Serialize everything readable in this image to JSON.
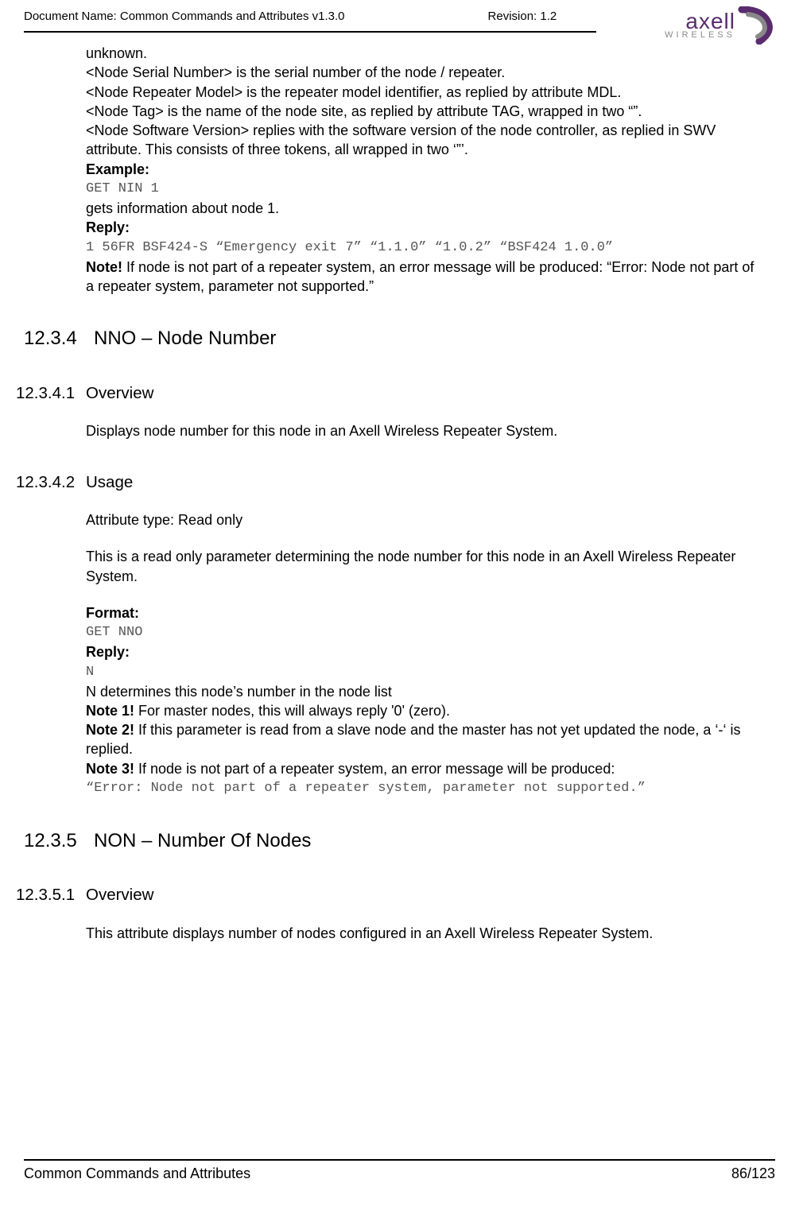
{
  "header": {
    "doc_name_label": "Document Name: Common Commands and Attributes v1.3.0",
    "revision_label": "Revision: 1.2",
    "logo_main": "axell",
    "logo_sub": "WIRELESS"
  },
  "body": {
    "unknown": "unknown.",
    "nsn": "<Node Serial Number> is the serial number of the node / repeater.",
    "nrm": "<Node Repeater Model> is the repeater model identifier, as replied by attribute MDL.",
    "ntag": "<Node Tag> is the name of the node site, as replied by attribute TAG, wrapped in two “”.",
    "nsv": "<Node Software Version> replies with the software version of the node controller, as replied in SWV attribute. This consists of three tokens, all wrapped in two ‘”’.",
    "example_label": "Example:",
    "example_code": "GET NIN 1",
    "example_desc": "gets information about node 1.",
    "reply_label": "Reply:",
    "reply_code": "1 56FR BSF424-S “Emergency exit 7” “1.1.0” “1.0.2” “BSF424 1.0.0”",
    "note_label": "Note!",
    "note_text": " If node is not part of a repeater system, an error message will be produced: “Error: Node not part of a repeater system, parameter not supported.”",
    "s1234_num": "12.3.4",
    "s1234_title": "NNO – Node Number",
    "s12341_num": "12.3.4.1",
    "s12341_title": "Overview",
    "s12341_body": "Displays node number for this node in an Axell Wireless Repeater System.",
    "s12342_num": "12.3.4.2",
    "s12342_title": "Usage",
    "s12342_attr": "Attribute type: Read only",
    "s12342_desc": "This is a read only parameter determining the node number for this node in an Axell Wireless Repeater System.",
    "format_label": "Format:",
    "format_code": "GET NNO",
    "reply2_label": "Reply:",
    "reply2_code": "N",
    "n_desc": "N determines this node’s number in the node list",
    "note1_label": "Note 1!",
    "note1_text": " For master nodes, this will always reply '0' (zero).",
    "note2_label": "Note 2!",
    "note2_text": " If this parameter is read from a slave node and the master has not yet updated the node, a ‘-‘ is replied.",
    "note3_label": "Note 3!",
    "note3_text": " If node is not part of a repeater system, an error message will be produced:",
    "error_code": "“Error: Node not part of a repeater system, parameter not supported.”",
    "s1235_num": "12.3.5",
    "s1235_title": "NON – Number Of Nodes",
    "s12351_num": "12.3.5.1",
    "s12351_title": "Overview",
    "s12351_body": "This attribute displays number of nodes configured in an Axell Wireless Repeater System."
  },
  "footer": {
    "left": "Common Commands and Attributes",
    "right": "86/123"
  }
}
